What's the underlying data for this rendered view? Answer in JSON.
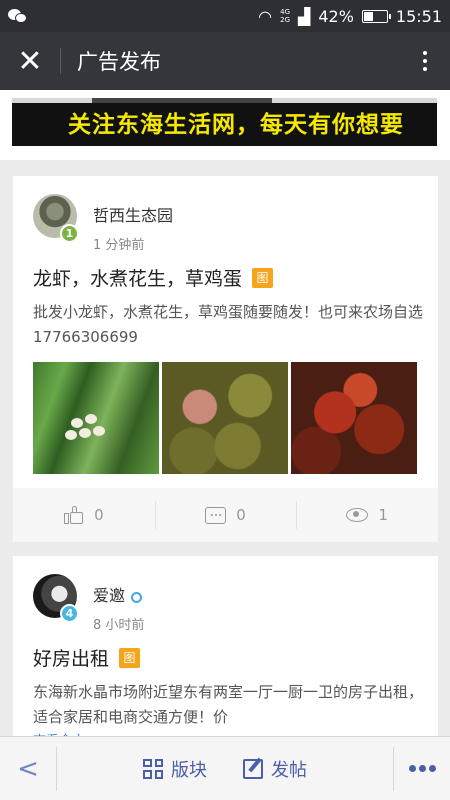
{
  "status_bar": {
    "signal_top": "4G",
    "signal_bottom": "2G",
    "battery_percent": "42%",
    "time": "15:51"
  },
  "header": {
    "title": "广告发布"
  },
  "banner": {
    "text": "关注东海生活网，每天有你想要"
  },
  "posts": [
    {
      "author": "哲西生态园",
      "level": "1",
      "time": "1 分钟前",
      "title": "龙虾，水煮花生，草鸡蛋",
      "image_tag": "图",
      "body": "批发小龙虾，水煮花生，草鸡蛋随要随发！也可来农场自选17766306699",
      "likes": "0",
      "comments": "0",
      "views": "1"
    },
    {
      "author": "爱邀",
      "level": "4",
      "time": "8 小时前",
      "title": "好房出租",
      "image_tag": "图",
      "body": "东海新水晶市场附近望东有两室一厅一厨一卫的房子出租，适合家居和电商交通方便！价",
      "more": "查看全文"
    }
  ],
  "bottom_nav": {
    "sections_label": "版块",
    "post_label": "发帖"
  }
}
